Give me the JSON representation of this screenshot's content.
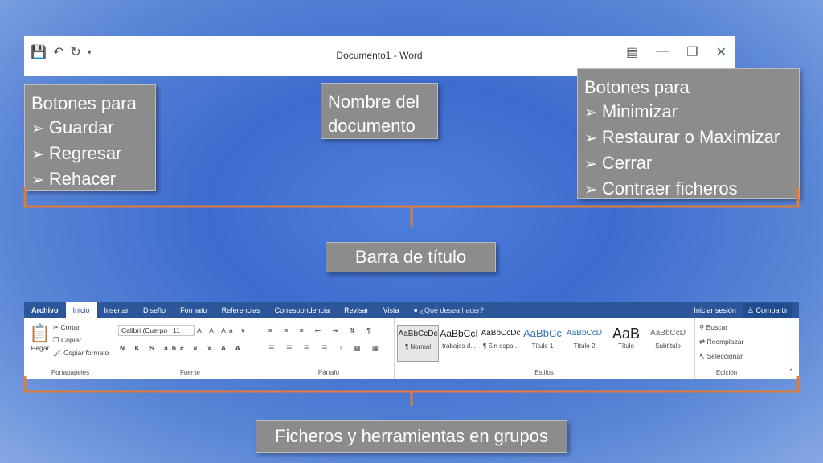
{
  "titlebar": {
    "doc_title": "Documento1 - Word",
    "left_icons": [
      "save-icon",
      "undo-icon",
      "redo-icon",
      "customize-icon"
    ],
    "right_icons": [
      "ribbon-display-icon",
      "minimize-icon",
      "restore-icon",
      "close-icon"
    ]
  },
  "callouts": {
    "left": {
      "title": "Botones para",
      "items": [
        "Guardar",
        "Regresar",
        "Rehacer"
      ]
    },
    "center": {
      "line1": "Nombre del",
      "line2": "documento"
    },
    "right": {
      "title": "Botones para",
      "items": [
        "Minimizar",
        "Restaurar o Maximizar",
        "Cerrar",
        "Contraer ficheros"
      ]
    }
  },
  "labels": {
    "title_bar": "Barra de título",
    "ribbon": "Ficheros y herramientas en grupos"
  },
  "ribbon": {
    "tabs": [
      "Archivo",
      "Inicio",
      "Insertar",
      "Diseño",
      "Formato",
      "Referencias",
      "Correspondencia",
      "Revisar",
      "Vista"
    ],
    "help": "¿Qué desea hacer?",
    "sign_in": "Iniciar sesión",
    "share": "Compartir",
    "clipboard": {
      "paste": "Pegar",
      "cut": "Cortar",
      "copy": "Copiar",
      "format_painter": "Copiar formato",
      "label": "Portapapeles"
    },
    "font": {
      "name": "Calibri (Cuerpo",
      "size": "11",
      "label": "Fuente"
    },
    "paragraph": {
      "label": "Párrafo"
    },
    "styles": {
      "label": "Estilos",
      "items": [
        {
          "sample": "AaBbCcDc",
          "name": "¶ Normal"
        },
        {
          "sample": "AaBbCcI",
          "name": "trabajos d..."
        },
        {
          "sample": "AaBbCcDc",
          "name": "¶ Sin espa..."
        },
        {
          "sample": "AaBbCc",
          "name": "Título 1"
        },
        {
          "sample": "AaBbCcD",
          "name": "Título 2"
        },
        {
          "sample": "AaB",
          "name": "Título"
        },
        {
          "sample": "AaBbCcD",
          "name": "Subtítulo"
        }
      ]
    },
    "editing": {
      "find": "Buscar",
      "replace": "Reemplazar",
      "select": "Seleccionar",
      "label": "Edición"
    }
  },
  "colors": {
    "accent": "#2b579a",
    "bracket": "#e07b39",
    "callout": "#8c8c8c"
  }
}
